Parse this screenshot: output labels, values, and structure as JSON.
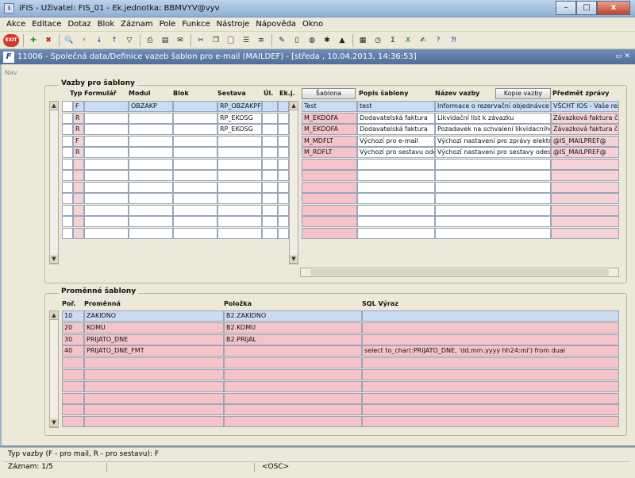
{
  "window": {
    "title": "iFIS - Uživatel: FIS_01 - Ek.jednotka: BBMVYV@vyv",
    "minimize": "–",
    "maximize": "□",
    "close": "x"
  },
  "menu": [
    "Akce",
    "Editace",
    "Dotaz",
    "Blok",
    "Záznam",
    "Pole",
    "Funkce",
    "Nástroje",
    "Nápověda",
    "Okno"
  ],
  "toolbar": {
    "exit_label": "EXIT",
    "icons": [
      "save-icon",
      "add-icon",
      "delete-icon",
      "search-icon",
      "sort-asc-icon",
      "sort-desc-icon",
      "filter-icon",
      "print-icon",
      "print-preview-icon",
      "mail-icon",
      "cut-icon",
      "copy-icon",
      "paste-icon",
      "list-icon",
      "list2-icon",
      "edit-icon",
      "open-icon",
      "save-doc-icon",
      "globe-icon",
      "gear-icon",
      "chart-icon",
      "calendar-icon",
      "calc-icon",
      "sum-icon",
      "excel-icon",
      "text-icon",
      "help-icon",
      "context-help-icon"
    ]
  },
  "form": {
    "icon": "F",
    "title": "11006 - Společná data/Definice vazeb šablon pro e-mail (MAILDEF) - [středa , 10.04.2013, 14:36:53]",
    "nav": "Nav",
    "restore_close": "▭ ✕"
  },
  "vazby": {
    "title": "Vazby pro šablony",
    "headers": {
      "typ": "Typ",
      "formular": "Formulář",
      "modul": "Modul",
      "blok": "Blok",
      "sestava": "Sestava",
      "ul": "Úl.",
      "ekj": "Ek.j.",
      "popis": "Popis šablony",
      "nazev": "Název vazby",
      "predmet": "Předmět zprávy"
    },
    "sablona_button": "Šablona",
    "kopie_button": "Kopie vazby",
    "rows": [
      {
        "typ": "F",
        "formular": "",
        "modul": "OBZAKP",
        "blok": "",
        "sestava": "RP_OBZAKPF",
        "sablona": "Test",
        "popis": "test",
        "nazev": "Informace o rezervační objednávce",
        "predmet": "VŠCHT IOS - Vaše rez"
      },
      {
        "typ": "R",
        "formular": "",
        "modul": "",
        "blok": "",
        "sestava": "RP_EKOSG",
        "sablona": "M_EKDOFA",
        "popis": "Dodavatelská faktura",
        "nazev": "Likvidační list k závazku",
        "predmet": "Závazková faktura čís"
      },
      {
        "typ": "R",
        "formular": "",
        "modul": "",
        "blok": "",
        "sestava": "RP_EKOSG",
        "sablona": "M_EKDOFA",
        "popis": "Dodavatelská faktura",
        "nazev": "Pozadavek na schvaleni likvidacniho li",
        "predmet": "Závazková faktura čís"
      },
      {
        "typ": "F",
        "formular": "",
        "modul": "",
        "blok": "",
        "sestava": "",
        "sablona": "M_MDFLT",
        "popis": "Výchozí pro e-mail",
        "nazev": "Výchozí nastavení pro zprávy elektron",
        "predmet": "@IS_MAILPREF@"
      },
      {
        "typ": "R",
        "formular": "",
        "modul": "",
        "blok": "",
        "sestava": "",
        "sablona": "M_RDFLT",
        "popis": "Výchozí pro sestavu ode",
        "nazev": "Výchozí nastavení pro sestavy odesíl",
        "predmet": "@IS_MAILPREF@"
      }
    ]
  },
  "promenne": {
    "title": "Proměnné šablony",
    "headers": {
      "por": "Poř.",
      "promenna": "Proměnná",
      "polozka": "Položka",
      "sql": "SQL Výraz"
    },
    "rows": [
      {
        "por": "10",
        "promenna": "ZAKIDNO",
        "polozka": "B2.ZAKIDNO",
        "sql": ""
      },
      {
        "por": "20",
        "promenna": "KOMU",
        "polozka": "B2.KOMU",
        "sql": ""
      },
      {
        "por": "30",
        "promenna": "PRIJATO_DNE",
        "polozka": "B2.PRIJAL",
        "sql": ""
      },
      {
        "por": "40",
        "promenna": "PRIJATO_DNE_FMT",
        "polozka": "",
        "sql": "select to_char(:PRIJATO_DNE, 'dd.mm.yyyy hh24:mi') from dual"
      }
    ]
  },
  "status": {
    "hint": "Typ vazby (F - pro mail, R - pro sestavu): F",
    "record": "Záznam: 1/5",
    "mode": "<OSC>"
  }
}
